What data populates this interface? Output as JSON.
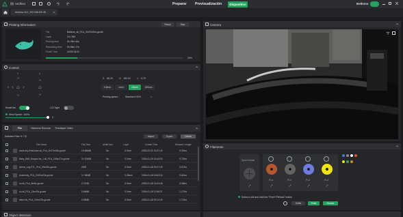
{
  "topbar": {
    "app_name": "Archivo",
    "nav_prepare": "Preparar",
    "nav_preview": "Previsualización",
    "nav_device": "Dispositivo",
    "user": "Bellemo"
  },
  "tabs": {
    "device_tab": "Anduino-M-2_192.168.100.35"
  },
  "printing": {
    "header": "Printing Information",
    "pause": "Pause",
    "stop": "Stop",
    "fields": [
      {
        "label": "File",
        "value": "Ballena_sb_PLA_2h07m53s.gcode"
      },
      {
        "label": "Layer",
        "value": "24 / 392"
      },
      {
        "label": "Printing time",
        "value": "0h 25m 40s"
      },
      {
        "label": "Remaining time",
        "value": "0h 56m 17s"
      },
      {
        "label": "Finish Time",
        "value": "02/28 18:31"
      }
    ],
    "progress_text": "23%",
    "progress": 0.23
  },
  "camera": {
    "header": "Camera"
  },
  "control": {
    "header": "Control",
    "temps": [
      {
        "label": "B:",
        "value": "60.20"
      },
      {
        "label": "N:",
        "value": "152.31"
      },
      {
        "label": "Z:",
        "value": "0.70"
      }
    ],
    "speed_buttons": [
      "0.5mm",
      "1mm",
      "10mm",
      "100mm"
    ],
    "printing_speed_label": "Printing speed :",
    "printing_speed_value": "Standard 100%",
    "model_fan_label": "Model fan",
    "led_label": "LCD light",
    "wind_speed_label": "Wind Speed : 100%",
    "wind_value": "0",
    "axis_labels": [
      "Y",
      "X",
      "Z"
    ]
  },
  "files": {
    "tabs": [
      "File",
      "Historical Records",
      "Timelapse Video"
    ],
    "selected": "Selected Files: 5 / 76",
    "actions": [
      "Import",
      "Export",
      "Delete"
    ],
    "columns": [
      "File Name",
      "File Size",
      "MultiColor",
      "Layer",
      "Create Time",
      "Moment Length"
    ],
    "rows": [
      {
        "name": "vault-key-final-base.stl_PLA_1h27m45s.gcode",
        "size": "19.6568B",
        "multi": "No",
        "layer": "0.2mm",
        "time": "2026-02-02 15:37:42",
        "length": "9.334m"
      },
      {
        "name": "Baby_Bull_Dragon-ha_1.stl_PLA_2h0m27s.gcode",
        "size": "21.5786B",
        "multi": "No",
        "layer": "0.2mm",
        "time": "2026-01-29 16:45:03",
        "length": "9.739m"
      },
      {
        "name": "Arena_Log.STL_PLA_29m29s.gcode",
        "size": "2MB",
        "multi": "No",
        "layer": "0.2mm",
        "time": "2026-01-28 09:37:39",
        "length": "3.672m"
      },
      {
        "name": "Assembly_PLA_2h57m23s.gcode",
        "size": "17.38MB",
        "multi": "No",
        "layer": "0.28mm",
        "time": "2026-01-28 18:03:44",
        "length": "9.624m"
      },
      {
        "name": "cu.stl_PLA_8m8s.gcode",
        "size": "0.37MB",
        "multi": "No",
        "layer": "0.2mm",
        "time": "2026-01-28 14:04:46",
        "length": "0.458m"
      },
      {
        "name": "cu.stl_PLA_13m43s.gcode",
        "size": "0.66MB",
        "multi": "No",
        "layer": "0.2mm",
        "time": "2026-01-28 13:58:37",
        "length": "1.172m"
      },
      {
        "name": "tinker.stl_PLA_1h1m23s.gcode",
        "size": "5.65MB",
        "multi": "No",
        "layer": "0.2mm",
        "time": "2026-01-28 09:12:29",
        "length": "1.724m"
      }
    ]
  },
  "filaments": {
    "header": "Filaments",
    "spool_holder": "Spool Holder",
    "slots": [
      {
        "material": "PLA",
        "color": "#b6572e"
      },
      {
        "material": "PLA",
        "color": "#636363"
      },
      {
        "material": "PLA",
        "color": "#6d7de0"
      },
      {
        "material": "PLA",
        "color": "#f2e30b"
      }
    ],
    "hint": "Select a slot and click the \"Feed\"/\"Retract\" button",
    "buttons": [
      "Settle",
      "Feed",
      "Retract"
    ],
    "palette": [
      "#3f7cd9",
      "#8a8a8a",
      "#f5f5f5",
      "#e34b3a",
      "#f2e30b",
      "#35a35a",
      "#d08a2a"
    ]
  },
  "object_detection": {
    "header": "Object detection"
  },
  "colors": {
    "accent": "#23a35f",
    "panel": "#252629",
    "header": "#2d2f33"
  }
}
